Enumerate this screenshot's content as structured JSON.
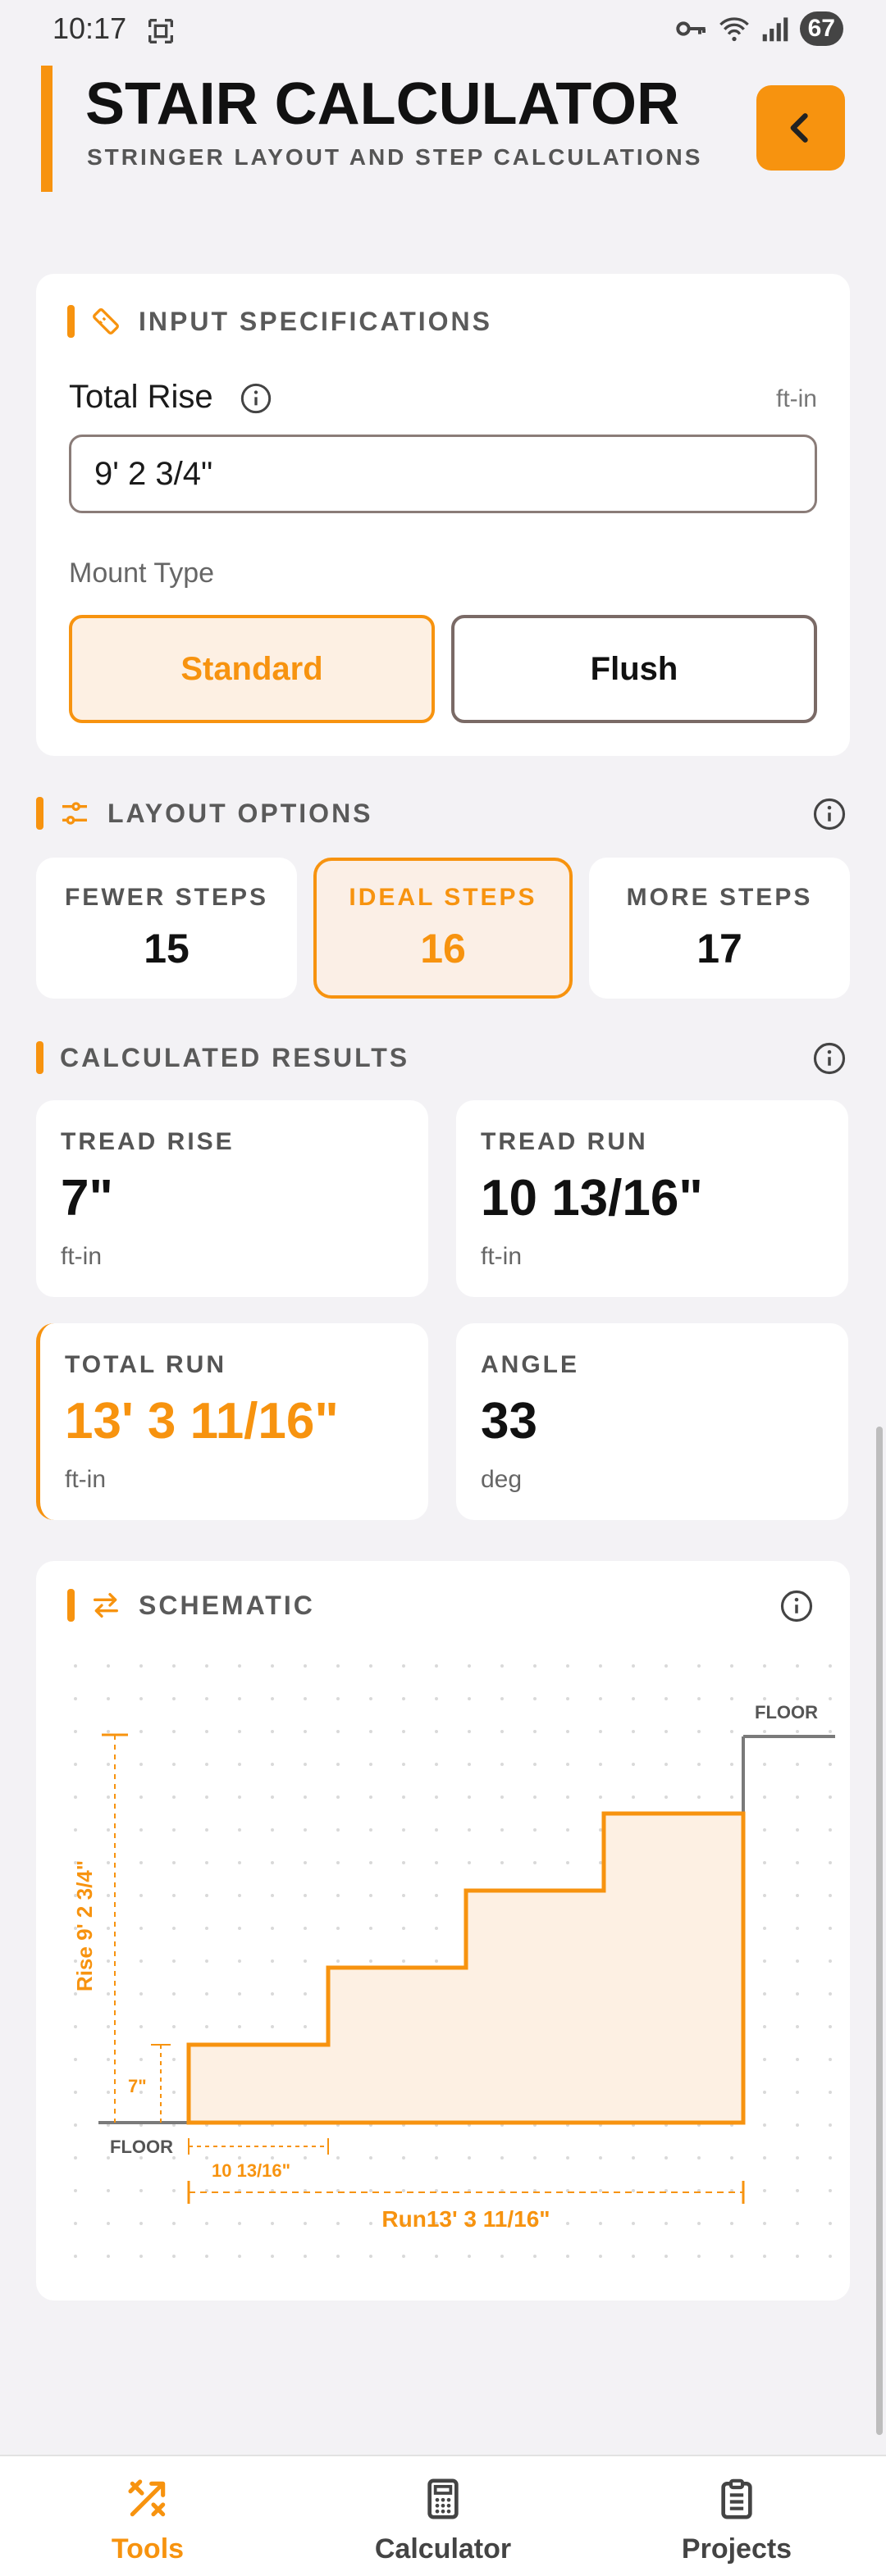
{
  "status_bar": {
    "time": "10:17",
    "battery": "67"
  },
  "header": {
    "title": "STAIR CALCULATOR",
    "subtitle": "STRINGER LAYOUT AND STEP CALCULATIONS"
  },
  "inputs": {
    "section_title": "INPUT SPECIFICATIONS",
    "total_rise_label": "Total Rise",
    "total_rise_unit": "ft-in",
    "total_rise_value": "9' 2 3/4\"",
    "mount_type_label": "Mount Type",
    "mount_options": [
      "Standard",
      "Flush"
    ],
    "mount_selected": "Standard"
  },
  "layout_options": {
    "section_title": "LAYOUT OPTIONS",
    "options": [
      {
        "label": "FEWER STEPS",
        "value": "15"
      },
      {
        "label": "IDEAL STEPS",
        "value": "16"
      },
      {
        "label": "MORE STEPS",
        "value": "17"
      }
    ],
    "selected": "IDEAL STEPS"
  },
  "results": {
    "section_title": "CALCULATED RESULTS",
    "tread_rise": {
      "label": "TREAD RISE",
      "value": "7\"",
      "unit": "ft-in"
    },
    "tread_run": {
      "label": "TREAD RUN",
      "value": "10 13/16\"",
      "unit": "ft-in"
    },
    "total_run": {
      "label": "TOTAL RUN",
      "value": "13' 3 11/16\"",
      "unit": "ft-in"
    },
    "angle": {
      "label": "ANGLE",
      "value": "33",
      "unit": "deg"
    }
  },
  "schematic": {
    "section_title": "SCHEMATIC",
    "floor_top": "FLOOR",
    "floor_bottom": "FLOOR",
    "rise_label": "Rise  9' 2 3/4\"",
    "step_rise_label": "7\"",
    "step_run_label": "10 13/16\"",
    "total_run_label": "Run13' 3 11/16\"",
    "visible_steps": 4
  },
  "bottom_nav": {
    "items": [
      {
        "label": "Tools",
        "icon": "tools-icon"
      },
      {
        "label": "Calculator",
        "icon": "calculator-icon"
      },
      {
        "label": "Projects",
        "icon": "clipboard-icon"
      }
    ],
    "active": "Tools"
  },
  "colors": {
    "accent": "#f7930f",
    "background": "#f3f2f5",
    "card": "#ffffff"
  }
}
